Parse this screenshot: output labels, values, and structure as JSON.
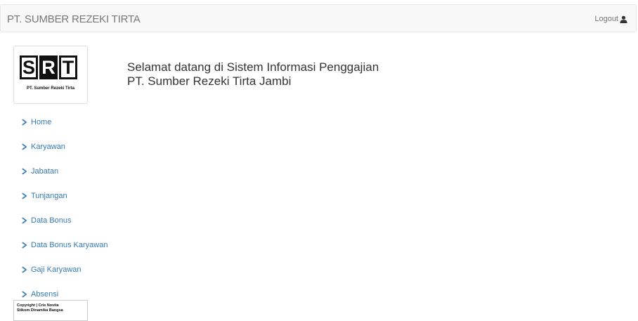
{
  "navbar": {
    "brand": "PT. SUMBER REZEKI TIRTA",
    "logout_label": "Logout"
  },
  "logo": {
    "letters": [
      "S",
      "R",
      "T"
    ],
    "caption": "PT. Sumber Rezeki Tirta"
  },
  "welcome": {
    "line1": "Selamat datang di Sistem Informasi Penggajian",
    "line2": "PT. Sumber Rezeki Tirta Jambi"
  },
  "menu": {
    "items": [
      {
        "label": "Home"
      },
      {
        "label": "Karyawan"
      },
      {
        "label": "Jabatan"
      },
      {
        "label": "Tunjangan"
      },
      {
        "label": "Data Bonus"
      },
      {
        "label": "Data Bonus Karyawan"
      },
      {
        "label": "Gaji Karyawan"
      },
      {
        "label": "Absensi"
      }
    ]
  },
  "footer": {
    "line1": "Copyright | Cris Novita",
    "line2": "Stikom Dinamika Bangsa"
  },
  "colors": {
    "link": "#337ab7",
    "navbar_bg": "#f8f8f8",
    "text": "#333333"
  },
  "icons": {
    "logout": "user-icon",
    "menu_bullet": "chevron-right-icon"
  }
}
